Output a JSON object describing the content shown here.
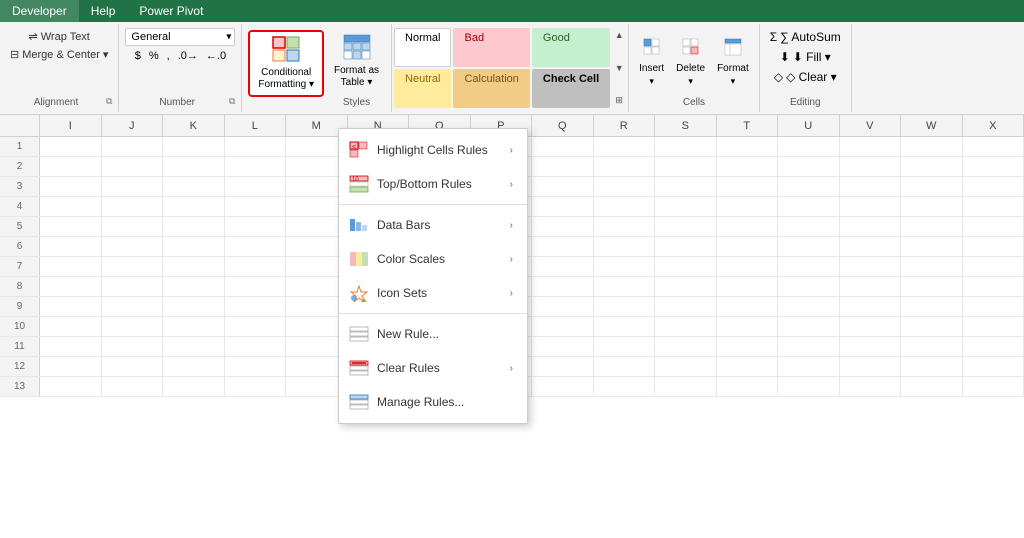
{
  "tabs": [
    "Developer",
    "Help",
    "Power Pivot"
  ],
  "ribbon": {
    "alignment": {
      "label": "Alignment",
      "wrap_text": "Wrap Text",
      "merge_center": "Merge & Center",
      "merge_arrow": "▾",
      "dialog_launcher": "⧉"
    },
    "number": {
      "label": "Number",
      "format_default": "General",
      "dollar": "$",
      "percent": "%",
      "comma": ",",
      "dec_inc": ".0→",
      "dec_dec": "←.0",
      "dialog_launcher": "⧉"
    },
    "conditional_formatting": {
      "label": "Conditional\nFormatting ▾",
      "label_line1": "Conditional",
      "label_line2": "Formatting ▾"
    },
    "format_as_table": {
      "label_line1": "Format as",
      "label_line2": "Table ▾"
    },
    "styles": {
      "label": "Styles",
      "normal": "Normal",
      "bad": "Bad",
      "good": "Good",
      "neutral": "Neutral",
      "calculation": "Calculation",
      "check_cell": "Check Cell"
    },
    "cells": {
      "label": "Cells",
      "insert": "Insert",
      "delete": "Delete",
      "format": "Format",
      "format_arrow": "▾",
      "insert_arrow": "▾",
      "delete_arrow": "▾"
    },
    "editing": {
      "label": "Editing",
      "autosum": "∑ AutoSum",
      "fill": "⬇ Fill ▾",
      "clear": "◇ Clear ▾"
    }
  },
  "column_headers": [
    "I",
    "J",
    "K",
    "L",
    "M",
    "N",
    "O",
    "P",
    "Q",
    "R",
    "S",
    "T",
    "U",
    "V",
    "W",
    "X"
  ],
  "menu": {
    "items": [
      {
        "id": "highlight",
        "label": "Highlight Cells Rules",
        "has_arrow": true
      },
      {
        "id": "topbottom",
        "label": "Top/Bottom Rules",
        "has_arrow": true
      },
      {
        "id": "databars",
        "label": "Data Bars",
        "has_arrow": true
      },
      {
        "id": "colorscales",
        "label": "Color Scales",
        "has_arrow": true
      },
      {
        "id": "iconsets",
        "label": "Icon Sets",
        "has_arrow": true
      },
      {
        "id": "newrule",
        "label": "New Rule...",
        "has_arrow": false
      },
      {
        "id": "clearrules",
        "label": "Clear Rules",
        "has_arrow": true
      },
      {
        "id": "managerules",
        "label": "Manage Rules...",
        "has_arrow": false
      }
    ]
  }
}
